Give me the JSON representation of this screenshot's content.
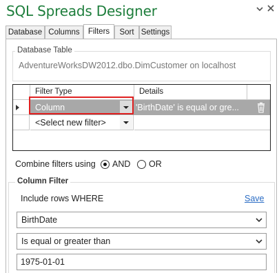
{
  "window": {
    "title": "SQL Spreads Designer",
    "dropdown_icon": "chevron-down-icon",
    "close_icon": "close-icon"
  },
  "tabs": [
    {
      "label": "Database",
      "active": false
    },
    {
      "label": "Columns",
      "active": false
    },
    {
      "label": "Filters",
      "active": true
    },
    {
      "label": "Sort",
      "active": false
    },
    {
      "label": "Settings",
      "active": false
    }
  ],
  "database_table": {
    "legend": "Database Table",
    "value": "AdventureWorksDW2012.dbo.DimCustomer on localhost"
  },
  "filter_grid": {
    "columns": [
      "Filter Type",
      "Details"
    ],
    "rows": [
      {
        "filter_type": "Column",
        "details": "'BirthDate' is equal or gre..."
      },
      {
        "filter_type": "<Select new filter>",
        "details": ""
      }
    ]
  },
  "combine": {
    "label": "Combine filters using",
    "and_label": "AND",
    "or_label": "OR",
    "selected": "AND"
  },
  "column_filter": {
    "legend": "Column Filter",
    "include_label": "Include rows WHERE",
    "save_label": "Save",
    "column_value": "BirthDate",
    "operator_value": "Is equal or greater than",
    "value": "1975-01-01"
  },
  "colors": {
    "title": "#1e7e3c",
    "highlight_border": "#e02020",
    "selected_row": "#a8a8a8",
    "link": "#2a6cc4"
  }
}
